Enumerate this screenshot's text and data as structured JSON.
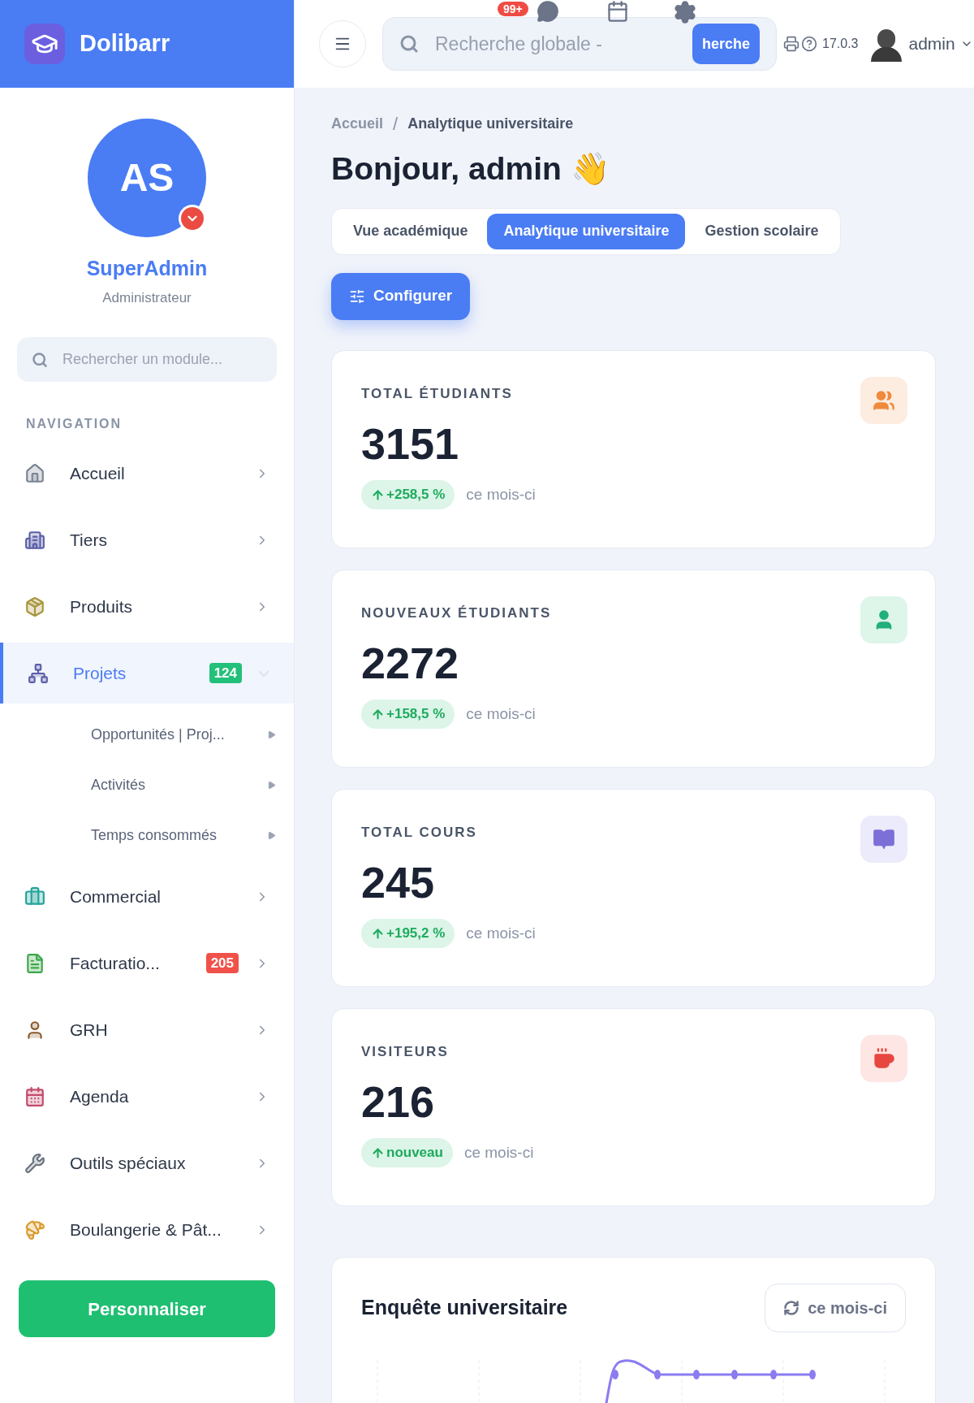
{
  "brand": {
    "name": "Dolibarr"
  },
  "header": {
    "search": {
      "placeholder": "Recherche globale -",
      "button": "herche"
    },
    "notifications": "99+",
    "version": "17.0.3",
    "user": "admin"
  },
  "profile": {
    "initials": "AS",
    "name": "SuperAdmin",
    "role": "Administrateur"
  },
  "module_search": {
    "placeholder": "Rechercher un module..."
  },
  "nav_heading": "NAVIGATION",
  "nav": [
    {
      "label": "Accueil",
      "kind": "home",
      "selected": false,
      "expanded": false
    },
    {
      "label": "Tiers",
      "kind": "building",
      "selected": false,
      "expanded": false
    },
    {
      "label": "Produits",
      "kind": "box",
      "selected": false,
      "expanded": false
    },
    {
      "label": "Projets",
      "kind": "network",
      "selected": true,
      "expanded": true,
      "badge": "124",
      "color": "#22c07a",
      "children": [
        {
          "label": "Opportunités | Proj..."
        },
        {
          "label": "Activités"
        },
        {
          "label": "Temps consommés"
        }
      ]
    },
    {
      "label": "Commercial",
      "kind": "briefcase",
      "selected": false,
      "expanded": false
    },
    {
      "label": "Facturatio...",
      "kind": "invoice",
      "selected": false,
      "expanded": false,
      "badge": "205",
      "color": "#f0524a"
    },
    {
      "label": "GRH",
      "kind": "person",
      "selected": false,
      "expanded": false
    },
    {
      "label": "Agenda",
      "kind": "calendar",
      "selected": false,
      "expanded": false
    },
    {
      "label": "Outils spéciaux",
      "kind": "tools",
      "selected": false,
      "expanded": false
    },
    {
      "label": "Boulangerie & Pât...",
      "kind": "bread",
      "selected": false,
      "expanded": false
    }
  ],
  "customize_button": "Personnaliser",
  "breadcrumb": {
    "items": [
      "Accueil",
      "Analytique universitaire"
    ],
    "separator": "/"
  },
  "greeting": "Bonjour, admin 👋",
  "tabs": [
    {
      "label": "Vue académique",
      "selected": false
    },
    {
      "label": "Analytique universitaire",
      "selected": true
    },
    {
      "label": "Gestion scolaire",
      "selected": false
    }
  ],
  "configure_button": "Configurer",
  "stats": [
    {
      "label": "TOTAL ÉTUDIANTS",
      "value": "3151",
      "change": "+258,5 %",
      "note": "ce mois-ci",
      "kind": "users"
    },
    {
      "label": "NOUVEAUX ÉTUDIANTS",
      "value": "2272",
      "change": "+158,5 %",
      "note": "ce mois-ci",
      "kind": "user"
    },
    {
      "label": "TOTAL COURS",
      "value": "245",
      "change": "+195,2 %",
      "note": "ce mois-ci",
      "kind": "book"
    },
    {
      "label": "VISITEURS",
      "value": "216",
      "change": "nouveau",
      "note": "ce mois-ci",
      "kind": "cup"
    }
  ],
  "survey": {
    "title": "Enquête universitaire",
    "period_button": "ce mois-ci"
  }
}
